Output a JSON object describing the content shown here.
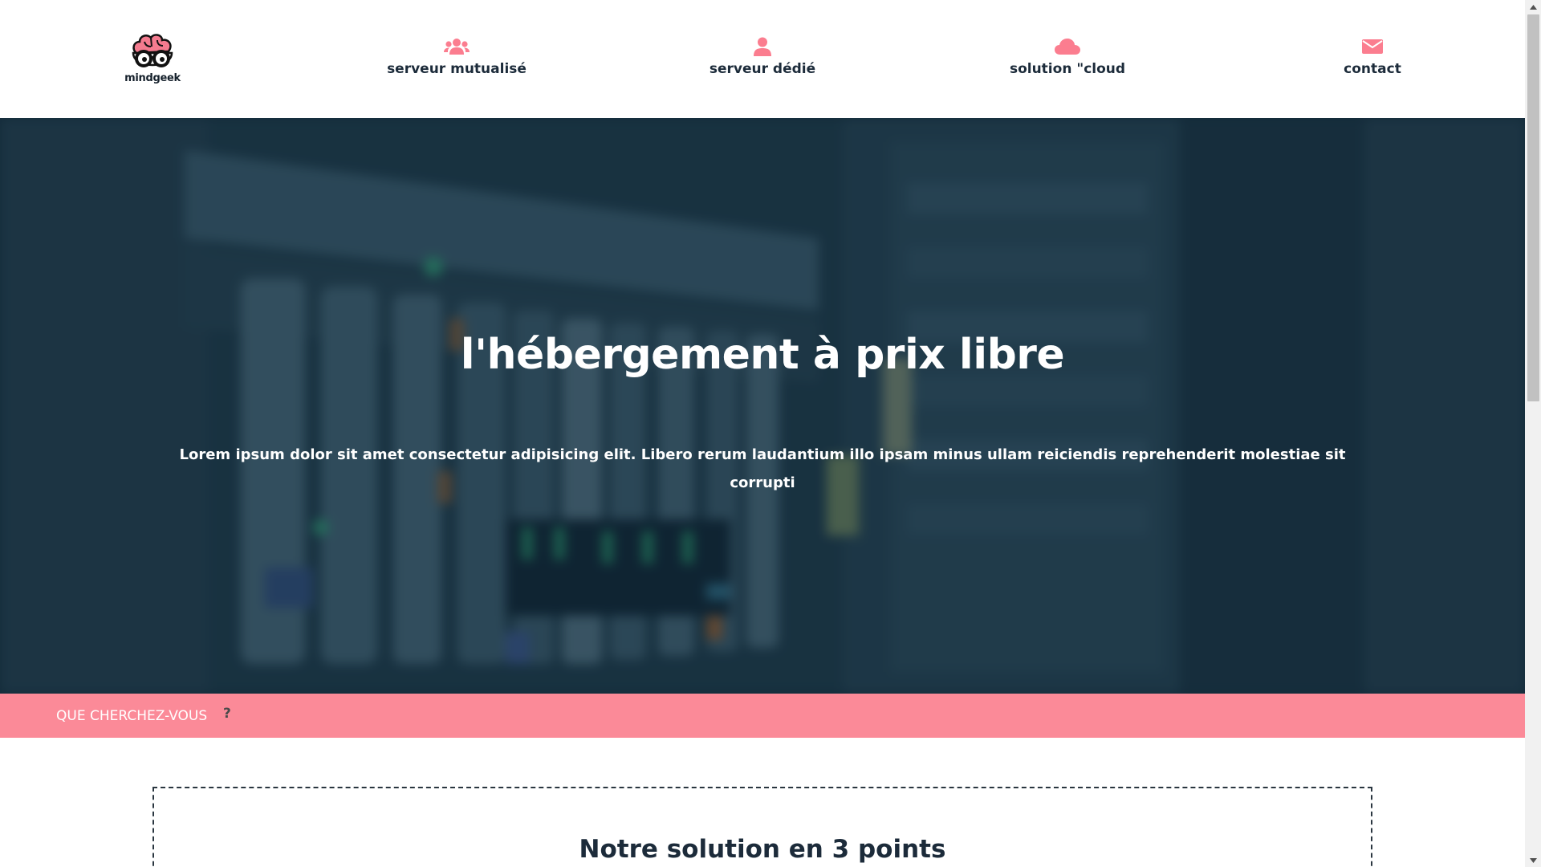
{
  "brand": {
    "name": "mindgeek",
    "accent_color": "#fb8a98",
    "dark_color": "#1c2b3a"
  },
  "nav": {
    "items": [
      {
        "label": "serveur mutualisé",
        "icon": "users-icon"
      },
      {
        "label": "serveur dédié",
        "icon": "user-icon"
      },
      {
        "label": "solution \"cloud",
        "icon": "cloud-icon"
      },
      {
        "label": "contact",
        "icon": "envelope-icon"
      }
    ]
  },
  "hero": {
    "title": "l'hébergement à prix libre",
    "text": "Lorem ipsum dolor sit amet consectetur adipisicing elit. Libero rerum laudantium illo ipsam minus ullam reiciendis reprehenderit molestiae sit corrupti",
    "background": "server-rack-photo"
  },
  "search": {
    "placeholder": "Que cherchez-vous",
    "suffix": "?"
  },
  "section": {
    "title": "Notre solution en 3 points"
  }
}
